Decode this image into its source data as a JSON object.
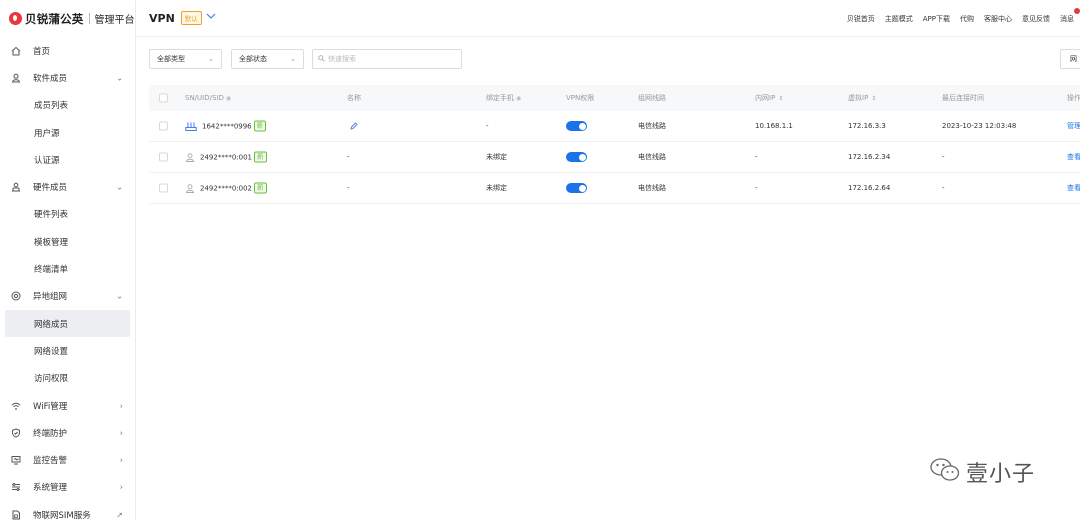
{
  "brand": {
    "name": "贝锐蒲公英",
    "sub": "管理平台"
  },
  "sidebar": {
    "items": [
      {
        "label": "首页",
        "type": "top",
        "icon": "home-icon",
        "arrow": ""
      },
      {
        "label": "软件成员",
        "type": "top",
        "icon": "user-icon",
        "arrow": "⌄"
      },
      {
        "label": "成员列表",
        "type": "sub"
      },
      {
        "label": "用户源",
        "type": "sub"
      },
      {
        "label": "认证源",
        "type": "sub"
      },
      {
        "label": "硬件成员",
        "type": "top",
        "icon": "hardware-user-icon",
        "arrow": "⌄"
      },
      {
        "label": "硬件列表",
        "type": "sub"
      },
      {
        "label": "模板管理",
        "type": "sub"
      },
      {
        "label": "终端清单",
        "type": "sub"
      },
      {
        "label": "异地组网",
        "type": "top",
        "icon": "network-icon",
        "arrow": "⌄"
      },
      {
        "label": "网络成员",
        "type": "sub",
        "active": true
      },
      {
        "label": "网络设置",
        "type": "sub"
      },
      {
        "label": "访问权限",
        "type": "sub"
      },
      {
        "label": "WiFi管理",
        "type": "top",
        "icon": "wifi-icon",
        "arrow": "›"
      },
      {
        "label": "终端防护",
        "type": "top",
        "icon": "shield-icon",
        "arrow": "›"
      },
      {
        "label": "监控告警",
        "type": "top",
        "icon": "monitor-icon",
        "arrow": "›"
      },
      {
        "label": "系统管理",
        "type": "top",
        "icon": "settings-icon",
        "arrow": "›"
      },
      {
        "label": "物联网SIM服务",
        "type": "top",
        "icon": "sim-icon",
        "arrow": "↗"
      }
    ]
  },
  "header": {
    "title": "VPN",
    "badge": "默认",
    "links": [
      "贝锐首页",
      "主题模式",
      "APP下载",
      "代购",
      "客服中心",
      "意见反馈",
      "消息"
    ]
  },
  "filters": {
    "type_select": "全部类型",
    "status_select": "全部状态",
    "search_placeholder": "快速搜索",
    "right_button": "网"
  },
  "table": {
    "columns": [
      "SN/UID/SID",
      "名称",
      "绑定手机",
      "VPN权限",
      "组网线路",
      "内网IP",
      "虚拟IP",
      "最后连接时间",
      "操作"
    ],
    "rows": [
      {
        "id": "1642****0996",
        "icon": "router-icon",
        "tag": "新",
        "name": "",
        "phone": "-",
        "vpn": true,
        "route": "电信线路",
        "lan_ip": "10.168.1.1",
        "vip": "172.16.3.3",
        "last": "2023-10-23 12:03:48",
        "action": "管理"
      },
      {
        "id": "2492****0:001",
        "icon": "person-icon",
        "tag": "新",
        "name": "-",
        "phone": "未绑定",
        "vpn": true,
        "route": "电信线路",
        "lan_ip": "-",
        "vip": "172.16.2.34",
        "last": "-",
        "action": "查看"
      },
      {
        "id": "2492****0:002",
        "icon": "person-icon",
        "tag": "新",
        "name": "-",
        "phone": "未绑定",
        "vpn": true,
        "route": "电信线路",
        "lan_ip": "-",
        "vip": "172.16.2.64",
        "last": "-",
        "action": "查看"
      }
    ]
  },
  "watermark": {
    "text": "壹小子"
  }
}
